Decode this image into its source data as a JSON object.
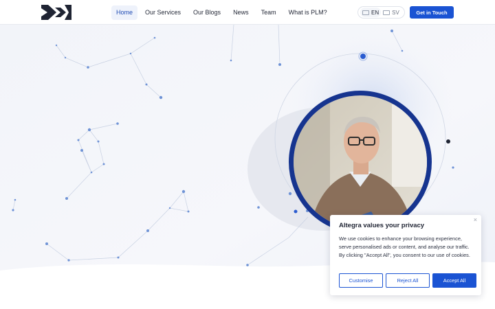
{
  "header": {
    "nav": [
      {
        "label": "Home",
        "active": true
      },
      {
        "label": "Our Services",
        "active": false
      },
      {
        "label": "Our Blogs",
        "active": false
      },
      {
        "label": "News",
        "active": false
      },
      {
        "label": "Team",
        "active": false
      },
      {
        "label": "What is PLM?",
        "active": false
      }
    ],
    "languages": [
      {
        "code": "EN",
        "active": true
      },
      {
        "code": "SV",
        "active": false
      }
    ],
    "cta_label": "Get in Touch"
  },
  "cookie": {
    "title": "Altegra values your privacy",
    "text": "We use cookies to enhance your browsing experience, serve personalised ads or content, and analyse our traffic. By clicking \"Accept All\", you consent to our use of cookies.",
    "close_icon": "×",
    "buttons": {
      "customise": "Customise",
      "reject": "Reject All",
      "accept": "Accept All"
    }
  },
  "colors": {
    "accent": "#1a53d3",
    "ring": "#16348f",
    "network_dot": "#4a7fd4"
  }
}
